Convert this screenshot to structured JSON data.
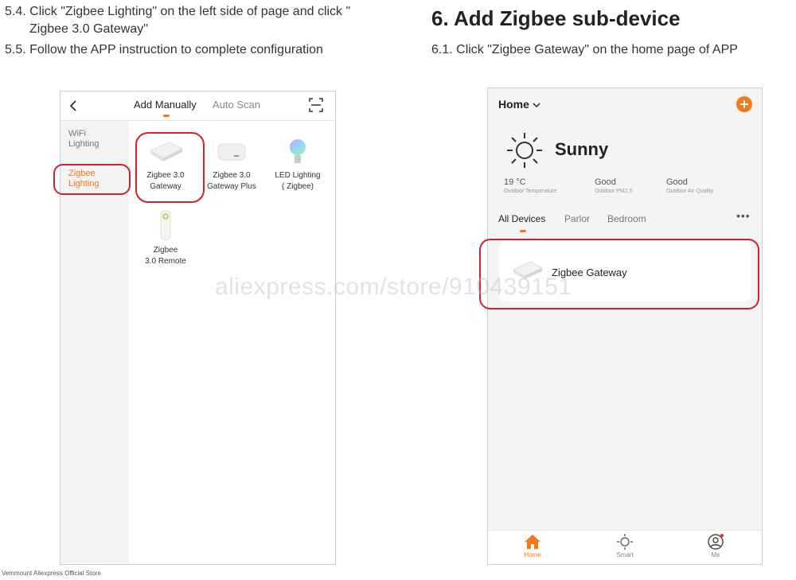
{
  "left": {
    "step_5_4_line1": "5.4. Click \"Zigbee Lighting\" on the left side of page and click \"",
    "step_5_4_line2": "Zigbee 3.0 Gateway\"",
    "step_5_5": "5.5. Follow the APP instruction to complete configuration",
    "phone": {
      "tab_manual": "Add Manually",
      "tab_auto": "Auto Scan",
      "sidebar": [
        "WiFi Lighting",
        "Zigbee Lighting"
      ],
      "devices": [
        {
          "line1": "Zigbee 3.0",
          "line2": "Gateway"
        },
        {
          "line1": "Zigbee 3.0",
          "line2": "Gateway Plus"
        },
        {
          "line1": "LED Lighting",
          "line2": "( Zigbee)"
        },
        {
          "line1": "Zigbee",
          "line2": "3.0 Remote"
        }
      ]
    }
  },
  "right": {
    "heading": "6. Add Zigbee sub-device",
    "step_6_1": "6.1. Click \"Zigbee Gateway\" on the home page of APP",
    "phone": {
      "home_label": "Home",
      "weather": "Sunny",
      "stats": [
        {
          "value": "19 °C",
          "label": "Outdoor Temperature"
        },
        {
          "value": "Good",
          "label": "Outdoor PM2.5"
        },
        {
          "value": "Good",
          "label": "Outdoor Air Quality"
        }
      ],
      "rooms": [
        "All Devices",
        "Parlor",
        "Bedroom"
      ],
      "device": "Zigbee Gateway",
      "nav": [
        "Home",
        "Smart",
        "Me"
      ]
    }
  },
  "watermark": "aliexpress.com/store/910439151",
  "footer": "Vemmount Aliexpress Official Store",
  "colors": {
    "accent": "#f07a1e",
    "highlight": "#d1202e"
  }
}
